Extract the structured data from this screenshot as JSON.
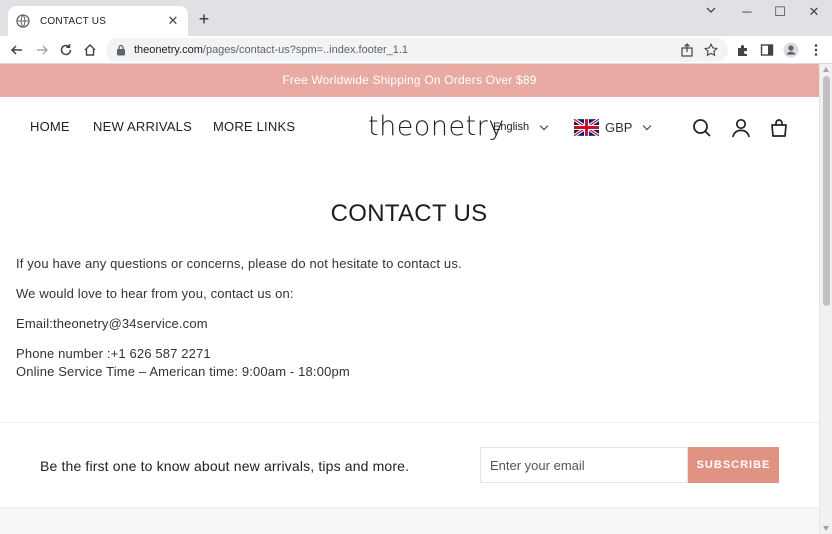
{
  "browser": {
    "tab_title": "CONTACT US",
    "tab_close": "✕",
    "new_tab": "+",
    "window_controls": {
      "minimize": "─",
      "maximize": "☐",
      "close": "✕"
    },
    "url_main": "theonetry.com",
    "url_rest": "/pages/contact-us?spm=..index.footer_1.1"
  },
  "page": {
    "announcement": "Free Worldwide Shipping On Orders Over $89",
    "nav": {
      "home": "HOME",
      "new_arrivals": "NEW ARRIVALS",
      "more_links": "MORE LINKS"
    },
    "logo": "theonetry",
    "language": "English",
    "currency": "GBP",
    "title": "CONTACT US",
    "paragraphs": {
      "intro": "If you have any questions or concerns, please do not hesitate to contact us.",
      "hear": "We would love to hear from you, contact us on:",
      "email": "Email:theonetry@34service.com",
      "phone": "Phone number :+1 626 587 2271",
      "service_time": "Online Service Time – American time: 9:00am - 18:00pm"
    },
    "newsletter": {
      "text": "Be the first one to know about new arrivals, tips and more.",
      "placeholder": "Enter your email",
      "button": "SUBSCRIBE"
    }
  },
  "colors": {
    "announcement_bg": "#e8aaa2",
    "subscribe_bg": "#e09383",
    "tabstrip_bg": "#dfe1e5"
  },
  "icons": [
    "globe-icon",
    "back-icon",
    "forward-icon",
    "reload-icon",
    "home-icon",
    "lock-icon",
    "share-icon",
    "star-icon",
    "extensions-icon",
    "sidepanel-icon",
    "profile-icon",
    "menu-icon",
    "search-icon",
    "account-icon",
    "cart-icon",
    "uk-flag-icon"
  ]
}
